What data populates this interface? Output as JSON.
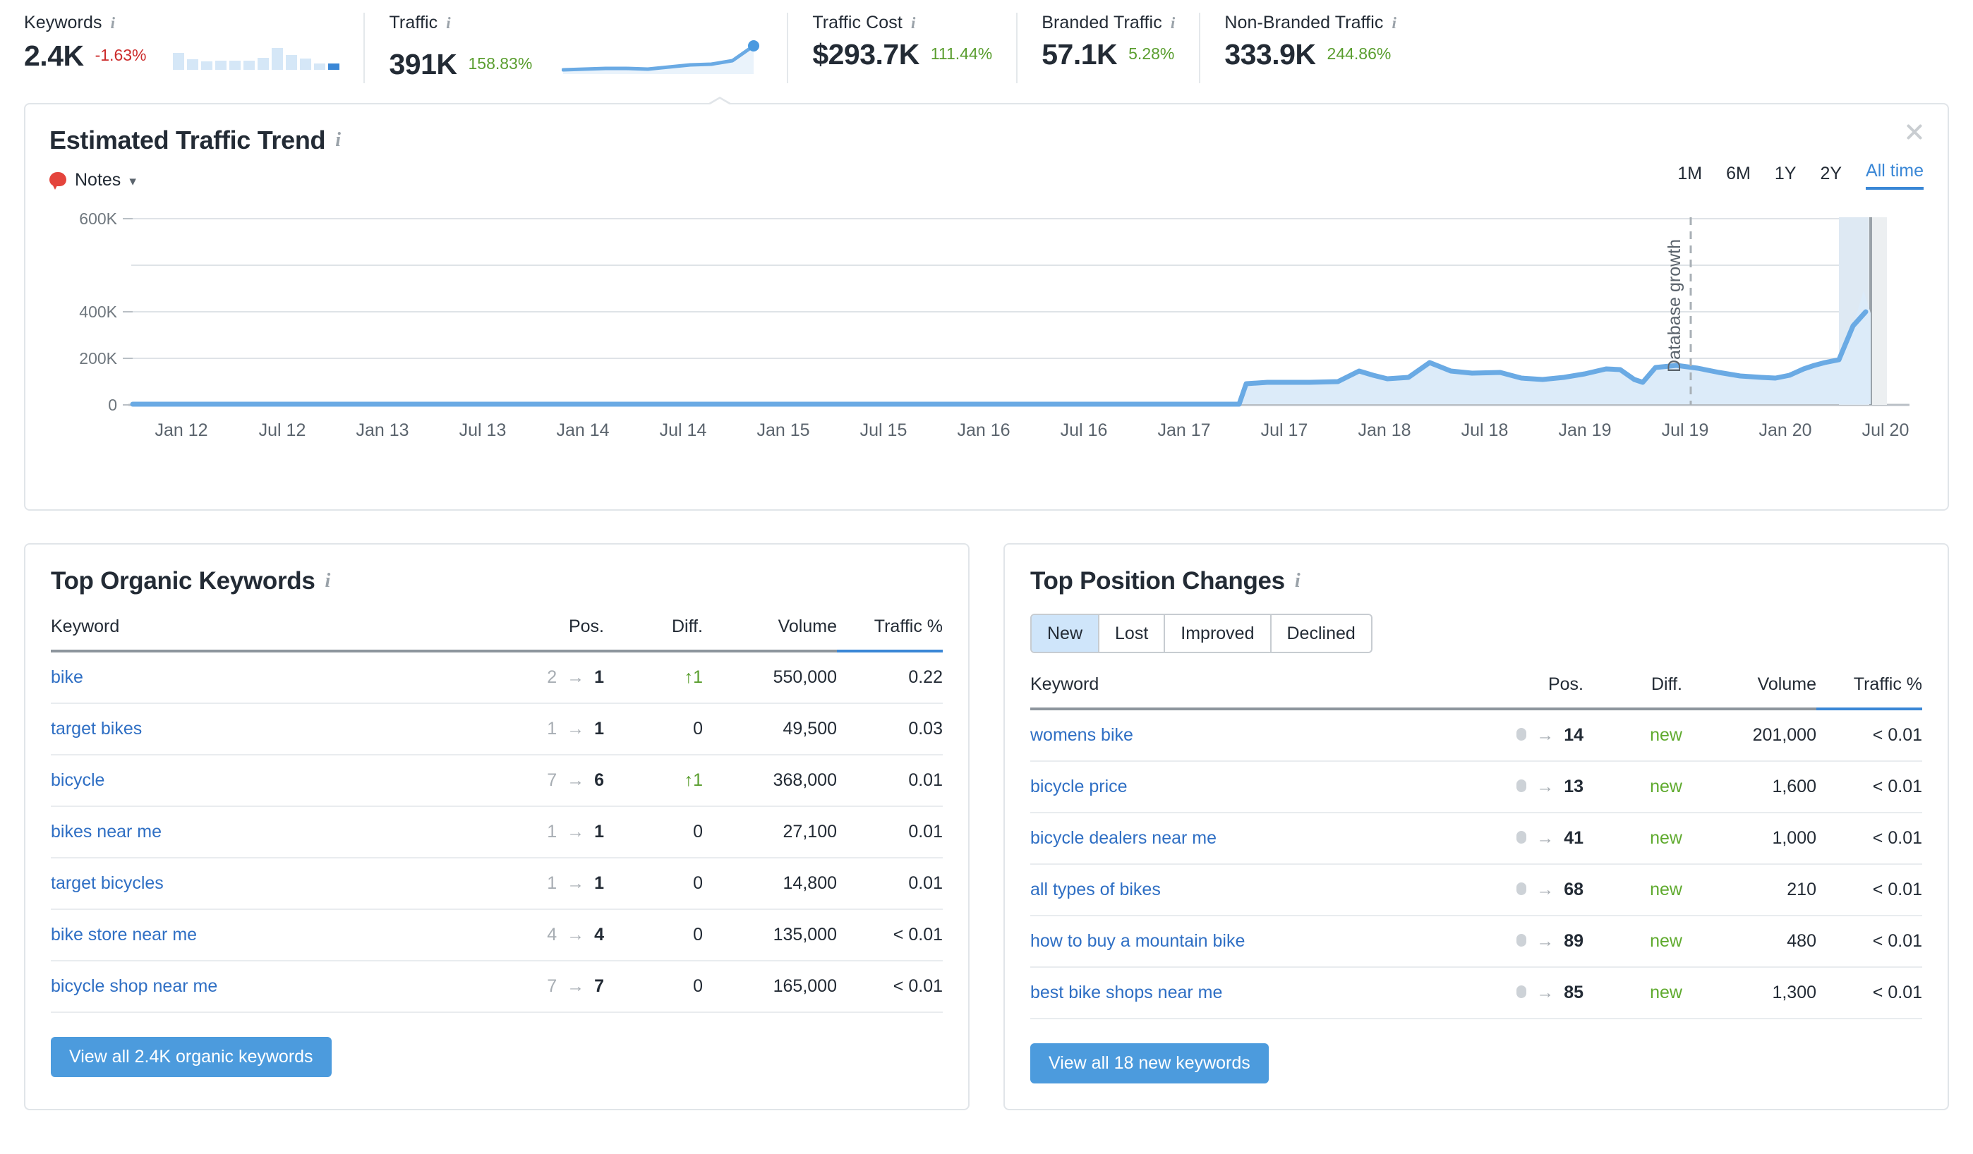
{
  "metrics": [
    {
      "label": "Keywords",
      "value": "2.4K",
      "delta": "-1.63%",
      "dir": "down",
      "spark": "bars"
    },
    {
      "label": "Traffic",
      "value": "391K",
      "delta": "158.83%",
      "dir": "up",
      "spark": "area"
    },
    {
      "label": "Traffic Cost",
      "value": "$293.7K",
      "delta": "111.44%",
      "dir": "up",
      "spark": "none"
    },
    {
      "label": "Branded Traffic",
      "value": "57.1K",
      "delta": "5.28%",
      "dir": "up",
      "spark": "none"
    },
    {
      "label": "Non-Branded Traffic",
      "value": "333.9K",
      "delta": "244.86%",
      "dir": "up",
      "spark": "none"
    }
  ],
  "trend": {
    "title": "Estimated Traffic Trend",
    "notes_label": "Notes",
    "ranges": [
      {
        "label": "1M",
        "active": false
      },
      {
        "label": "6M",
        "active": false
      },
      {
        "label": "1Y",
        "active": false
      },
      {
        "label": "2Y",
        "active": false
      },
      {
        "label": "All time",
        "active": true
      }
    ]
  },
  "chart_data": {
    "type": "area",
    "title": "Estimated Traffic Trend",
    "xlabel": "",
    "ylabel": "",
    "ylim": [
      0,
      600000
    ],
    "yticks": [
      0,
      200000,
      400000,
      600000
    ],
    "ytick_labels": [
      "0",
      "200K",
      "400K",
      "600K"
    ],
    "grid": true,
    "legend": "none",
    "annotations": [
      {
        "label": "Database growth",
        "x": "Jul 19",
        "style": "dashed-vertical"
      }
    ],
    "xtick_labels": [
      "Jan 12",
      "Jul 12",
      "Jan 13",
      "Jul 13",
      "Jan 14",
      "Jul 14",
      "Jan 15",
      "Jul 15",
      "Jan 16",
      "Jul 16",
      "Jan 17",
      "Jul 17",
      "Jan 18",
      "Jul 18",
      "Jan 19",
      "Jul 19",
      "Jan 20",
      "Jul 20"
    ],
    "series": [
      {
        "name": "Estimated Traffic",
        "color": "#6aaae4",
        "fill": "#dcebf9",
        "x": [
          "Jan 12",
          "Apr 12",
          "Jul 12",
          "Oct 12",
          "Jan 13",
          "Apr 13",
          "Jul 13",
          "Oct 13",
          "Jan 14",
          "Apr 14",
          "Jul 14",
          "Oct 14",
          "Jan 15",
          "Apr 15",
          "Jul 15",
          "Oct 15",
          "Jan 16",
          "Apr 16",
          "Jul 16",
          "Oct 16",
          "Jan 17",
          "Apr 17",
          "Jul 17",
          "Oct 17",
          "Jan 18",
          "Apr 18",
          "Jul 18",
          "Oct 18",
          "Jan 19",
          "Apr 19",
          "Jul 19",
          "Oct 19",
          "Jan 20",
          "Apr 20",
          "Jul 20",
          "Oct 20",
          "Dec 20"
        ],
        "values": [
          2000,
          2000,
          2000,
          2000,
          2000,
          2000,
          2000,
          2000,
          2000,
          2000,
          2000,
          2000,
          2000,
          2000,
          2000,
          2000,
          2000,
          2000,
          2000,
          2000,
          2000,
          2500,
          36000,
          38000,
          38000,
          48000,
          42000,
          58000,
          44000,
          44000,
          42000,
          40000,
          38000,
          52000,
          48000,
          62000,
          391000
        ]
      }
    ]
  },
  "organic": {
    "title": "Top Organic Keywords",
    "columns": [
      "Keyword",
      "Pos.",
      "Diff.",
      "Volume",
      "Traffic %"
    ],
    "sorted_column": "Traffic %",
    "rows": [
      {
        "keyword": "bike",
        "pos_from": "2",
        "pos_to": "1",
        "diff": "1",
        "diff_dir": "up",
        "volume": "550,000",
        "traffic": "0.22"
      },
      {
        "keyword": "target bikes",
        "pos_from": "1",
        "pos_to": "1",
        "diff": "0",
        "diff_dir": "flat",
        "volume": "49,500",
        "traffic": "0.03"
      },
      {
        "keyword": "bicycle",
        "pos_from": "7",
        "pos_to": "6",
        "diff": "1",
        "diff_dir": "up",
        "volume": "368,000",
        "traffic": "0.01"
      },
      {
        "keyword": "bikes near me",
        "pos_from": "1",
        "pos_to": "1",
        "diff": "0",
        "diff_dir": "flat",
        "volume": "27,100",
        "traffic": "0.01"
      },
      {
        "keyword": "target bicycles",
        "pos_from": "1",
        "pos_to": "1",
        "diff": "0",
        "diff_dir": "flat",
        "volume": "14,800",
        "traffic": "0.01"
      },
      {
        "keyword": "bike store near me",
        "pos_from": "4",
        "pos_to": "4",
        "diff": "0",
        "diff_dir": "flat",
        "volume": "135,000",
        "traffic": "< 0.01"
      },
      {
        "keyword": "bicycle shop near me",
        "pos_from": "7",
        "pos_to": "7",
        "diff": "0",
        "diff_dir": "flat",
        "volume": "165,000",
        "traffic": "< 0.01"
      }
    ],
    "button": "View all 2.4K organic keywords"
  },
  "position_changes": {
    "title": "Top Position Changes",
    "tabs": [
      {
        "label": "New",
        "active": true
      },
      {
        "label": "Lost",
        "active": false
      },
      {
        "label": "Improved",
        "active": false
      },
      {
        "label": "Declined",
        "active": false
      }
    ],
    "columns": [
      "Keyword",
      "Pos.",
      "Diff.",
      "Volume",
      "Traffic %"
    ],
    "sorted_column": "Traffic %",
    "rows": [
      {
        "keyword": "womens bike",
        "pos_from": "",
        "pos_to": "14",
        "diff": "new",
        "volume": "201,000",
        "traffic": "< 0.01"
      },
      {
        "keyword": "bicycle price",
        "pos_from": "",
        "pos_to": "13",
        "diff": "new",
        "volume": "1,600",
        "traffic": "< 0.01"
      },
      {
        "keyword": "bicycle dealers near me",
        "pos_from": "",
        "pos_to": "41",
        "diff": "new",
        "volume": "1,000",
        "traffic": "< 0.01"
      },
      {
        "keyword": "all types of bikes",
        "pos_from": "",
        "pos_to": "68",
        "diff": "new",
        "volume": "210",
        "traffic": "< 0.01"
      },
      {
        "keyword": "how to buy a mountain bike",
        "pos_from": "",
        "pos_to": "89",
        "diff": "new",
        "volume": "480",
        "traffic": "< 0.01"
      },
      {
        "keyword": "best bike shops near me",
        "pos_from": "",
        "pos_to": "85",
        "diff": "new",
        "volume": "1,300",
        "traffic": "< 0.01"
      }
    ],
    "button": "View all 18 new keywords"
  },
  "colors": {
    "accent": "#3a87d6",
    "line": "#6aaae4",
    "fill": "#dcebf9",
    "positive": "#5a9e2f",
    "negative": "#cc2b2b",
    "link": "#2f6fc4"
  }
}
